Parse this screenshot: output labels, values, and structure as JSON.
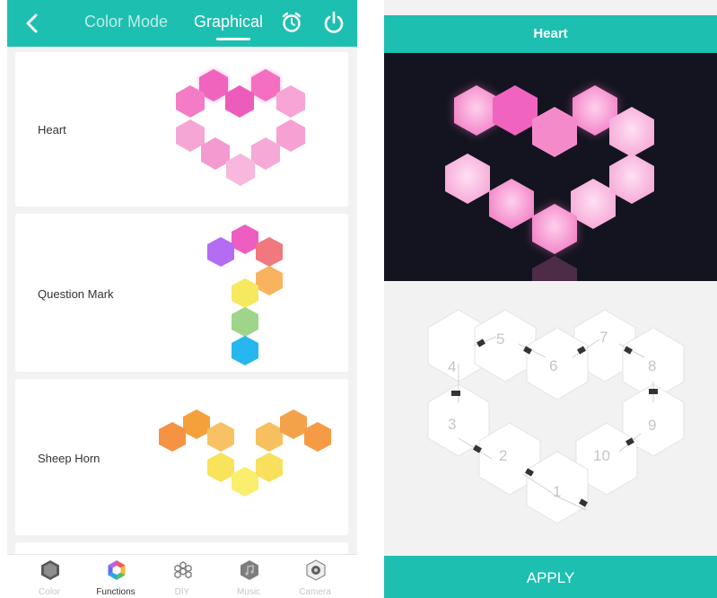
{
  "left_panel": {
    "header": {
      "color_mode_tab": "Color Mode",
      "graphical_tab": "Graphical"
    },
    "cards": [
      {
        "label": "Heart"
      },
      {
        "label": "Question Mark"
      },
      {
        "label": "Sheep Horn"
      }
    ],
    "bottom_nav": [
      {
        "label": "Color",
        "icon": "color-icon",
        "active": false
      },
      {
        "label": "Functions",
        "icon": "functions-icon",
        "active": true
      },
      {
        "label": "DIY",
        "icon": "diy-icon",
        "active": false
      },
      {
        "label": "Music",
        "icon": "music-icon",
        "active": false
      },
      {
        "label": "Camera",
        "icon": "camera-icon",
        "active": false
      }
    ]
  },
  "right_panel": {
    "title": "Heart",
    "panel_numbers": [
      "1",
      "2",
      "3",
      "4",
      "5",
      "6",
      "7",
      "8",
      "9",
      "10"
    ],
    "apply_label": "APPLY"
  },
  "colors": {
    "accent": "#1dbfb0",
    "preview_background": "#13141f",
    "heart_pink": "#f48cc8"
  }
}
